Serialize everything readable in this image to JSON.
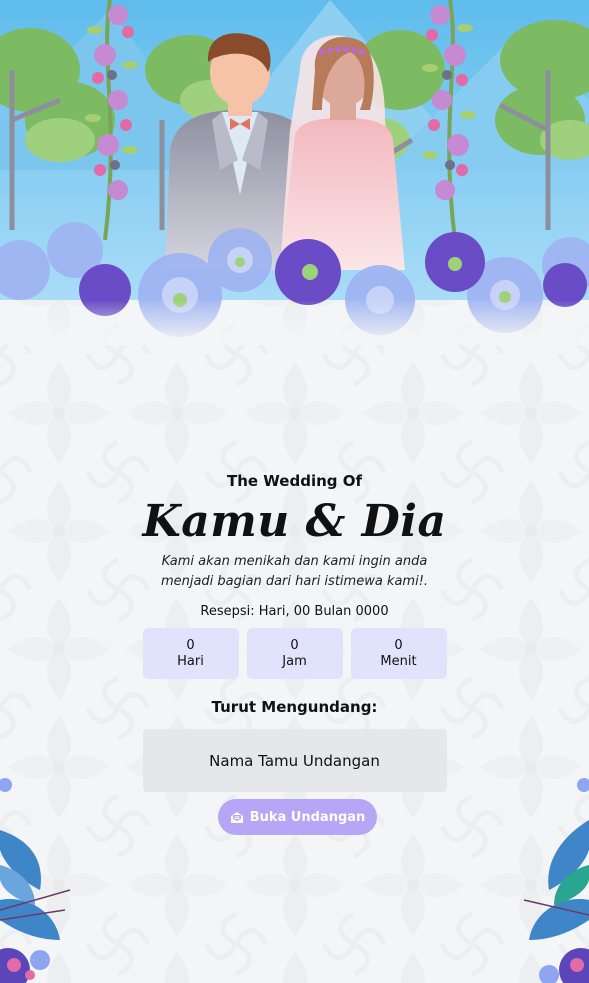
{
  "header": {
    "subtitle": "The Wedding Of",
    "couple_names": "Kamu & Dia",
    "message": "Kami akan menikah dan kami ingin anda menjadi bagian dari hari istimewa kami!."
  },
  "reception": {
    "text": "Resepsi: Hari, 00 Bulan 0000"
  },
  "countdown": [
    {
      "value": "0",
      "label": "Hari"
    },
    {
      "value": "0",
      "label": "Jam"
    },
    {
      "value": "0",
      "label": "Menit"
    }
  ],
  "invitation": {
    "heading": "Turut Mengundang:",
    "guest_name": "Nama Tamu Undangan"
  },
  "open_button": {
    "label": "Buka Undangan",
    "icon": "envelope-open-icon"
  },
  "colors": {
    "sky": "#6fc3ef",
    "countdown_box": "#e0e3fb",
    "guest_box": "#e5e7ea",
    "button": "#b6a6f6",
    "flower_blue": "#8ea6f2",
    "flower_purple": "#6a4cc6"
  }
}
